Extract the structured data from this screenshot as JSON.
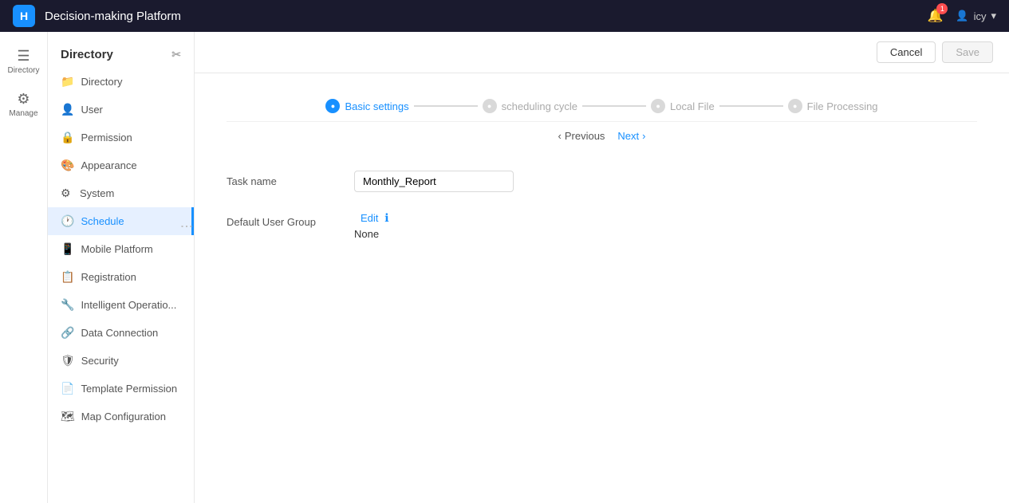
{
  "topbar": {
    "logo": "H",
    "title": "Decision-making Platform",
    "notif_count": "1",
    "user_icon": "👤",
    "username": "icy",
    "dropdown_icon": "▾"
  },
  "left_nav": {
    "items": [
      {
        "icon": "☰",
        "label": "Directory",
        "active": true
      },
      {
        "icon": "⚙",
        "label": "Manage",
        "active": false
      }
    ]
  },
  "sidebar": {
    "header": "Directory",
    "pin_icon": "📌",
    "items": [
      {
        "icon": "📁",
        "label": "Directory",
        "active": false
      },
      {
        "icon": "👤",
        "label": "User",
        "active": false
      },
      {
        "icon": "🔒",
        "label": "Permission",
        "active": false
      },
      {
        "icon": "🎨",
        "label": "Appearance",
        "active": false
      },
      {
        "icon": "⚙",
        "label": "System",
        "active": false
      },
      {
        "icon": "🕐",
        "label": "Schedule",
        "active": true
      },
      {
        "icon": "📱",
        "label": "Mobile Platform",
        "active": false
      },
      {
        "icon": "📋",
        "label": "Registration",
        "active": false
      },
      {
        "icon": "🔧",
        "label": "Intelligent Operatio...",
        "active": false
      },
      {
        "icon": "🔗",
        "label": "Data Connection",
        "active": false
      },
      {
        "icon": "🛡",
        "label": "Security",
        "active": false
      },
      {
        "icon": "📄",
        "label": "Template Permission",
        "active": false
      },
      {
        "icon": "🗺",
        "label": "Map Configuration",
        "active": false
      }
    ]
  },
  "toolbar": {
    "cancel_label": "Cancel",
    "save_label": "Save"
  },
  "steps": [
    {
      "label": "Basic settings",
      "status": "active"
    },
    {
      "label": "scheduling cycle",
      "status": "inactive"
    },
    {
      "label": "Local File",
      "status": "inactive"
    },
    {
      "label": "File Processing",
      "status": "inactive"
    }
  ],
  "navigation": {
    "prev_label": "Previous",
    "next_label": "Next"
  },
  "form": {
    "task_name_label": "Task name",
    "task_name_value": "Monthly_Report",
    "default_user_group_label": "Default User Group",
    "edit_label": "Edit",
    "group_value": "None"
  }
}
